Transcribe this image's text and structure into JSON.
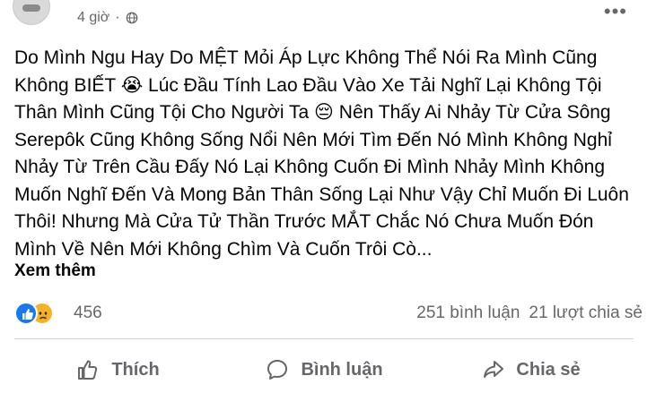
{
  "post": {
    "time": "4 giờ",
    "separator": "·",
    "text": "Do Mình Ngu Hay Do MỆT Mỏi Áp Lực Không Thể Nói Ra Mình Cũng Không BIẾT 😭 Lúc Đầu Tính Lao Đầu Vào Xe Tải Nghĩ Lại Không Tội Thân Mình Cũng Tội Cho Người Ta 😔 Nên Thấy Ai Nhảy Từ Cửa Sông Serepôk Cũng Không Sống Nổi Nên Mới Tìm Đến Nó Mình Không Nghỉ Nhảy Từ Trên Cầu Đấy Nó Lại Không Cuốn Đi Mình Nhảy Mình Không Muốn Nghĩ Đến Và Mong Bản Thân Sống Lại Như Vậy Chỉ Muốn Đi Luôn Thôi! Nhưng Mà Cửa Tử Thần Trước MẮT Chắc Nó Chưa Muốn Đón Mình Về Nên Mới Không Chìm Và Cuốn Trôi Cò...",
    "see_more": "Xem thêm"
  },
  "reactions": {
    "icons": [
      "like-icon",
      "sad-icon"
    ],
    "count": "456",
    "comments": "251 bình luận",
    "shares": "21 lượt chia sẻ"
  },
  "actions": {
    "like": "Thích",
    "comment": "Bình luận",
    "share": "Chia sẻ"
  },
  "colors": {
    "like_blue": "#1877f2",
    "sad_yellow": "#f7b125",
    "secondary_text": "#65676b"
  }
}
